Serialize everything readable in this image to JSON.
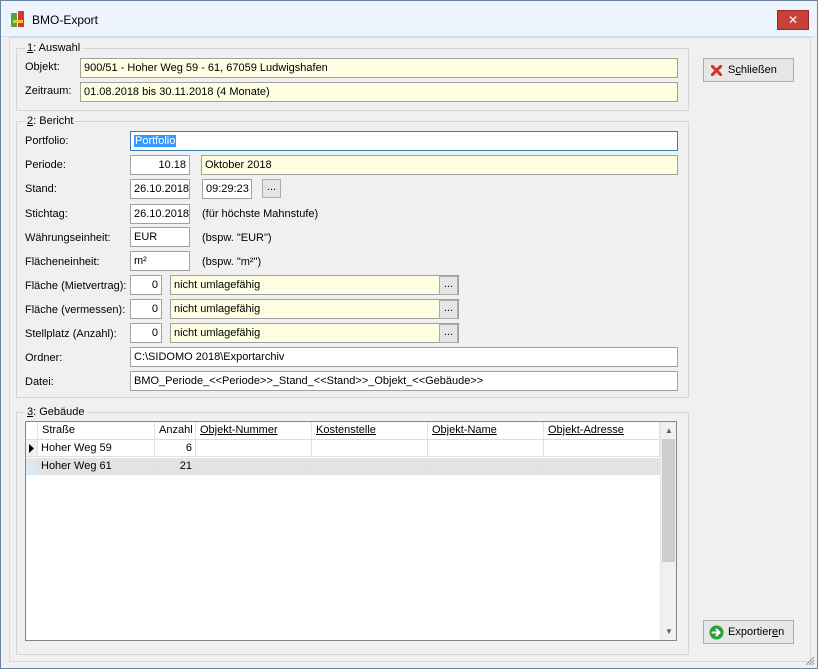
{
  "window": {
    "title": "BMO-Export",
    "close_glyph": "✕"
  },
  "auswahl": {
    "title_u": "1",
    "title_rest": ": Auswahl",
    "objekt_label": "Objekt:",
    "objekt_value": "900/51 - Hoher Weg 59 - 61, 67059 Ludwigshafen",
    "zeitraum_label": "Zeitraum:",
    "zeitraum_value": "01.08.2018 bis 30.11.2018 (4 Monate)"
  },
  "bericht": {
    "title_u": "2",
    "title_rest": ": Bericht",
    "portfolio_label": "Portfolio:",
    "portfolio_value": "Portfolio",
    "periode_label": "Periode:",
    "periode_value": "10.18",
    "periode_text": "Oktober 2018",
    "stand_label": "Stand:",
    "stand_date": "26.10.2018",
    "stand_time": "09:29:23",
    "stand_btn": "...",
    "stichtag_label": "Stichtag:",
    "stichtag_value": "26.10.2018",
    "stichtag_hint": "(für höchste Mahnstufe)",
    "waehrung_label": "Währungseinheit:",
    "waehrung_value": "EUR",
    "waehrung_hint": "(bspw. \"EUR\")",
    "flaecheneinheit_label": "Flächeneinheit:",
    "flaecheneinheit_value": "m²",
    "flaecheneinheit_hint": "(bspw. \"m²\")",
    "flaeche_miet_label": "Fläche (Mietvertrag):",
    "flaeche_miet_value": "0",
    "flaeche_miet_select": "nicht umlagefähig",
    "flaeche_verm_label": "Fläche (vermessen):",
    "flaeche_verm_value": "0",
    "flaeche_verm_select": "nicht umlagefähig",
    "stellplatz_label": "Stellplatz (Anzahl):",
    "stellplatz_value": "0",
    "stellplatz_select": "nicht umlagefähig",
    "dots": "...",
    "ordner_label": "Ordner:",
    "ordner_value": "C:\\SIDOMO 2018\\Exportarchiv",
    "datei_label": "Datei:",
    "datei_value": "BMO_Periode_<<Periode>>_Stand_<<Stand>>_Objekt_<<Gebäude>>"
  },
  "gebaeude": {
    "title_u": "3",
    "title_rest": ": Gebäude",
    "columns": [
      "Straße",
      "Anzahl",
      "Objekt-Nummer",
      "Kostenstelle",
      "Objekt-Name",
      "Objekt-Adresse"
    ],
    "rows": [
      {
        "strasse": "Hoher Weg 59",
        "anzahl": "6",
        "nummer": "",
        "kostenstelle": "",
        "name": "",
        "adresse": ""
      },
      {
        "strasse": "Hoher Weg 61",
        "anzahl": "21",
        "nummer": "",
        "kostenstelle": "",
        "name": "",
        "adresse": ""
      }
    ],
    "scroll_up": "▲",
    "scroll_down": "▼"
  },
  "buttons": {
    "schliessen_pre": "S",
    "schliessen_u": "c",
    "schliessen_post": "hließen",
    "exportieren_pre": "Exportier",
    "exportieren_u": "e",
    "exportieren_post": "n"
  },
  "colors": {
    "field_yellow": "#fefee2",
    "selection": "#3399ff",
    "close_red": "#c7403a",
    "export_green": "#27a339"
  }
}
